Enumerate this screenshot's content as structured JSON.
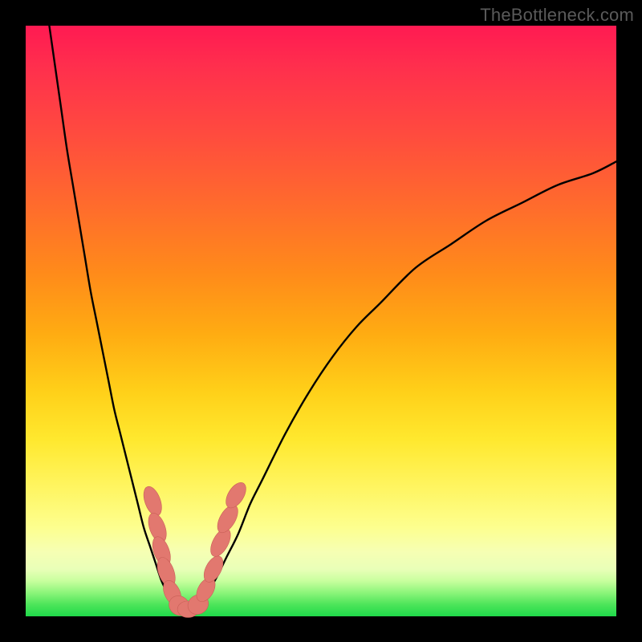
{
  "watermark": "TheBottleneck.com",
  "colors": {
    "curve_stroke": "#000000",
    "marker_fill": "#e2786f",
    "marker_stroke": "#c95f57"
  },
  "chart_data": {
    "type": "line",
    "title": "",
    "xlabel": "",
    "ylabel": "",
    "xlim": [
      0,
      100
    ],
    "ylim": [
      0,
      100
    ],
    "series": [
      {
        "name": "bottleneck-curve",
        "x": [
          4,
          5,
          6,
          7,
          8,
          9,
          10,
          11,
          12,
          13,
          14,
          15,
          16,
          17,
          18,
          19,
          20,
          21,
          22,
          23,
          24,
          25,
          26,
          27,
          28,
          30,
          32,
          34,
          36,
          38,
          40,
          44,
          48,
          52,
          56,
          60,
          66,
          72,
          78,
          84,
          90,
          96,
          100
        ],
        "y": [
          100,
          93,
          86,
          79,
          73,
          67,
          61,
          55,
          50,
          45,
          40,
          35,
          31,
          27,
          23,
          19,
          15,
          12,
          9,
          6,
          4,
          2.5,
          1.5,
          1,
          1.5,
          3,
          6,
          10,
          14,
          19,
          23,
          31,
          38,
          44,
          49,
          53,
          59,
          63,
          67,
          70,
          73,
          75,
          77
        ]
      }
    ],
    "markers": [
      {
        "x": 21.5,
        "y": 19.5,
        "rx": 1.3,
        "ry": 2.6,
        "angle": -20
      },
      {
        "x": 22.3,
        "y": 15.0,
        "rx": 1.3,
        "ry": 2.6,
        "angle": -20
      },
      {
        "x": 23.0,
        "y": 11.0,
        "rx": 1.3,
        "ry": 2.6,
        "angle": -20
      },
      {
        "x": 23.8,
        "y": 7.5,
        "rx": 1.3,
        "ry": 2.6,
        "angle": -20
      },
      {
        "x": 24.8,
        "y": 4.0,
        "rx": 1.3,
        "ry": 2.2,
        "angle": -25
      },
      {
        "x": 26.0,
        "y": 1.8,
        "rx": 1.6,
        "ry": 1.8,
        "angle": -55
      },
      {
        "x": 27.5,
        "y": 1.2,
        "rx": 1.8,
        "ry": 1.4,
        "angle": 0
      },
      {
        "x": 29.2,
        "y": 2.0,
        "rx": 1.6,
        "ry": 1.8,
        "angle": 55
      },
      {
        "x": 30.5,
        "y": 4.5,
        "rx": 1.3,
        "ry": 2.2,
        "angle": 30
      },
      {
        "x": 31.8,
        "y": 8.0,
        "rx": 1.3,
        "ry": 2.4,
        "angle": 28
      },
      {
        "x": 33.0,
        "y": 12.5,
        "rx": 1.3,
        "ry": 2.6,
        "angle": 28
      },
      {
        "x": 34.2,
        "y": 16.5,
        "rx": 1.3,
        "ry": 2.6,
        "angle": 30
      },
      {
        "x": 35.6,
        "y": 20.5,
        "rx": 1.3,
        "ry": 2.4,
        "angle": 32
      }
    ]
  }
}
